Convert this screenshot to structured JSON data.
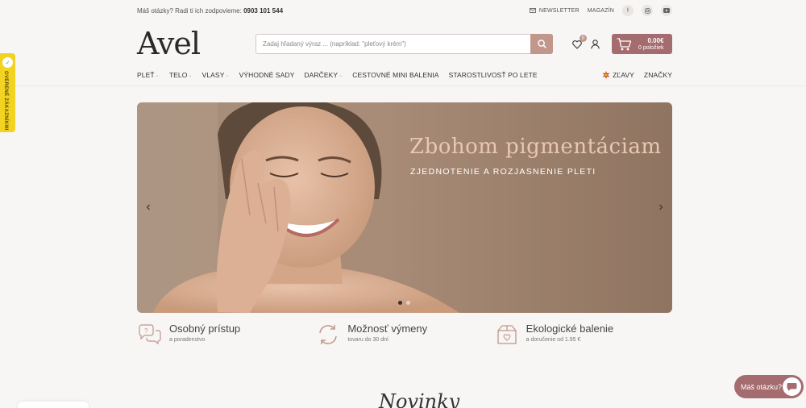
{
  "topbar": {
    "question": "Máš otázky? Radi ti ich zodpovieme:",
    "phone": "0903 101 544",
    "newsletter": "NEWSLETTER",
    "magazine": "MAGAZÍN"
  },
  "header": {
    "logo": "Avel",
    "search_placeholder": "Zadaj hľadaný výraz ... (napríklad: \"pleťový krém\")",
    "wishlist_count": "0",
    "cart_total": "0.00€",
    "cart_items": "0 položiek"
  },
  "nav": {
    "items": [
      {
        "label": "PLEŤ",
        "dropdown": true
      },
      {
        "label": "TELO",
        "dropdown": true
      },
      {
        "label": "VLASY",
        "dropdown": true
      },
      {
        "label": "VÝHODNÉ SADY",
        "dropdown": false
      },
      {
        "label": "DARČEKY",
        "dropdown": true
      },
      {
        "label": "CESTOVNÉ MINI BALENIA",
        "dropdown": false
      },
      {
        "label": "STAROSTLIVOSŤ PO LETE",
        "dropdown": false
      }
    ],
    "sale": "ZĽAVY",
    "brands": "ZNAČKY"
  },
  "hero": {
    "title": "Zbohom pigmentáciam",
    "subtitle": "ZJEDNOTENIE A ROZJASNENIE PLETI",
    "slide_count": 2,
    "active_slide": 1
  },
  "features": [
    {
      "title": "Osobný prístup",
      "subtitle": "a poradenstvo",
      "icon": "chat-bubbles-icon"
    },
    {
      "title": "Možnosť výmeny",
      "subtitle": "tovaru do 30 dní",
      "icon": "exchange-arrows-icon"
    },
    {
      "title": "Ekologické balenie",
      "subtitle": "a doručenie od 1.95 €",
      "icon": "eco-box-icon"
    }
  ],
  "badge": {
    "text": "OVERENÉ ZÁKAZNÍKMI"
  },
  "chat": {
    "label": "Máš otázku?"
  },
  "section": {
    "title": "Novinky"
  },
  "colors": {
    "accent": "#a46c6e",
    "search_button": "#c0978a",
    "badge": "#f3d321"
  }
}
